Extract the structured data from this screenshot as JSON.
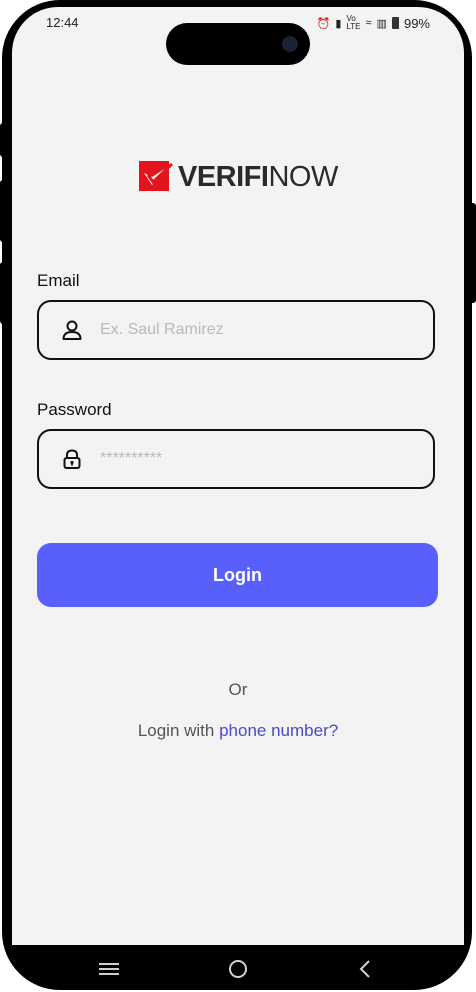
{
  "status_bar": {
    "time": "12:44",
    "battery_label": "99%",
    "icons": [
      "alarm-icon",
      "vibrate-icon",
      "volte-icon",
      "wifi-icon",
      "signal-icon",
      "battery-icon"
    ]
  },
  "brand": {
    "logo_bold": "VERIFI",
    "logo_light": "NOW",
    "accent_color": "#e3141b"
  },
  "form": {
    "email_label": "Email",
    "email_placeholder": "Ex. Saul Ramirez",
    "email_value": "",
    "email_icon": "user-icon",
    "password_label": "Password",
    "password_placeholder": "**********",
    "password_value": "",
    "password_icon": "lock-icon"
  },
  "actions": {
    "login_label": "Login",
    "login_color": "#585ffa",
    "or_text": "Or",
    "alt_login_prefix": "Login with ",
    "alt_login_link": "phone number?"
  },
  "nav": {
    "icons": [
      "recent-apps-icon",
      "home-icon",
      "back-icon"
    ]
  }
}
